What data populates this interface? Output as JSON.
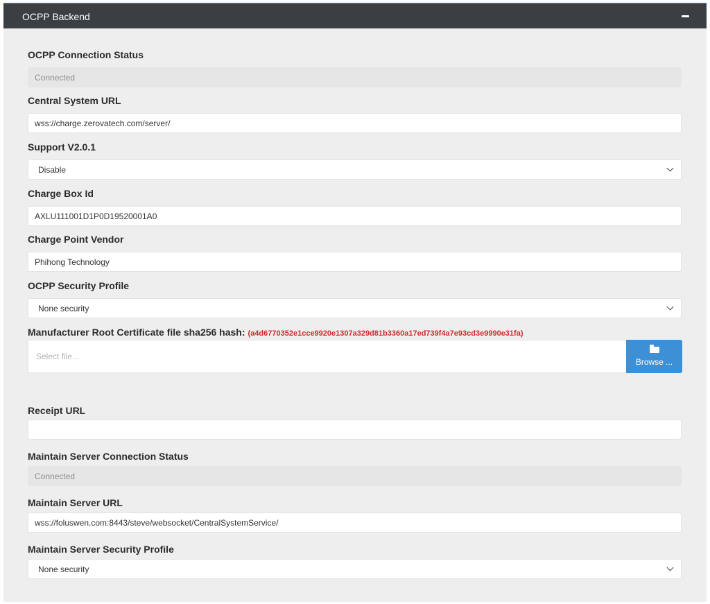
{
  "panel": {
    "title": "OCPP Backend",
    "collapse_icon": "minus-icon"
  },
  "ocpp_status": {
    "label": "OCPP Connection Status",
    "value": "Connected"
  },
  "central_url": {
    "label": "Central System URL",
    "value": "wss://charge.zerovatech.com/server/"
  },
  "support_v201": {
    "label": "Support V2.0.1",
    "value": "Disable"
  },
  "charge_box_id": {
    "label": "Charge Box Id",
    "value": "AXLU111001D1P0D19520001A0"
  },
  "vendor": {
    "label": "Charge Point Vendor",
    "value": "Phihong Technology"
  },
  "security_profile": {
    "label": "OCPP Security Profile",
    "value": "None security"
  },
  "root_cert": {
    "label": "Manufacturer Root Certificate file sha256 hash:",
    "hash": "(a4d6770352e1cce9920e1307a329d81b3360a17ed739f4a7e93cd3e9990e31fa)",
    "placeholder": "Select file...",
    "browse_label": "Browse ...",
    "browse_icon": "folder-open-icon",
    "hash_color": "#d22b2b",
    "button_color": "#3d8fd6"
  },
  "receipt_url": {
    "label": "Receipt URL",
    "value": ""
  },
  "maintain_status": {
    "label": "Maintain Server Connection Status",
    "value": "Connected"
  },
  "maintain_url": {
    "label": "Maintain Server URL",
    "value": "wss://foluswen.com:8443/steve/websocket/CentralSystemService/"
  },
  "maintain_security": {
    "label": "Maintain Server Security Profile",
    "value": "None security"
  }
}
